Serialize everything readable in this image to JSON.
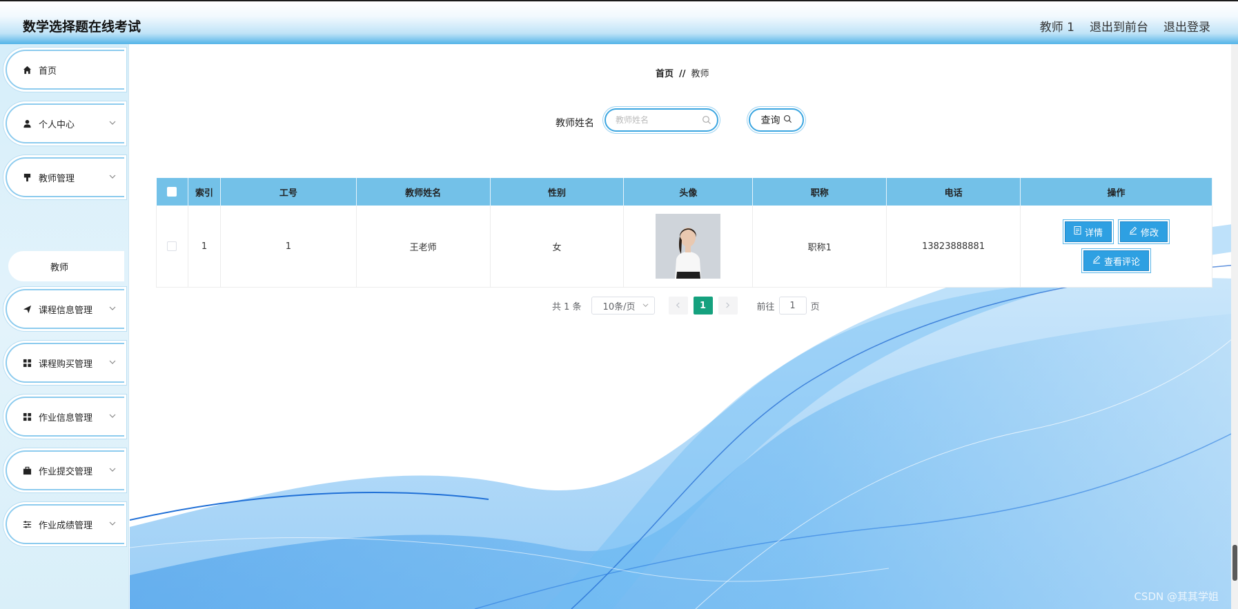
{
  "header": {
    "app_title": "数学选择题在线考试",
    "user": "教师 1",
    "back_to_front": "退出到前台",
    "logout": "退出登录"
  },
  "sidebar": {
    "items": [
      {
        "label": "首页",
        "icon": "home-icon",
        "expandable": false
      },
      {
        "label": "个人中心",
        "icon": "user-icon",
        "expandable": true
      },
      {
        "label": "教师管理",
        "icon": "brush-icon",
        "expandable": true
      },
      {
        "label": "课程信息管理",
        "icon": "send-icon",
        "expandable": true
      },
      {
        "label": "课程购买管理",
        "icon": "grid-icon",
        "expandable": true
      },
      {
        "label": "作业信息管理",
        "icon": "grid-icon",
        "expandable": true
      },
      {
        "label": "作业提交管理",
        "icon": "briefcase-icon",
        "expandable": true
      },
      {
        "label": "作业成绩管理",
        "icon": "sliders-icon",
        "expandable": true
      }
    ],
    "sub_item": "教师"
  },
  "breadcrumb": {
    "home": "首页",
    "separator": "//",
    "current": "教师"
  },
  "search": {
    "label": "教师姓名",
    "placeholder": "教师姓名",
    "value": "",
    "query_label": "查询"
  },
  "table": {
    "columns": [
      "索引",
      "工号",
      "教师姓名",
      "性别",
      "头像",
      "职称",
      "电话",
      "操作"
    ],
    "rows": [
      {
        "index": "1",
        "job_no": "1",
        "name": "王老师",
        "gender": "女",
        "avatar": "avatar-photo",
        "title": "职称1",
        "phone": "13823888881"
      }
    ],
    "actions": {
      "detail": "详情",
      "edit": "修改",
      "reviews": "查看评论"
    }
  },
  "pagination": {
    "total": "共 1 条",
    "page_size": "10条/页",
    "current_page": "1",
    "goto_label": "前往",
    "goto_value": "1",
    "page_unit": "页"
  },
  "watermark": "CSDN @其其学姐",
  "colors": {
    "accent": "#2ea0e2",
    "table_header": "#73c1e8",
    "page_active": "#15a17e",
    "topbar_bottom": "#52b3e8"
  }
}
